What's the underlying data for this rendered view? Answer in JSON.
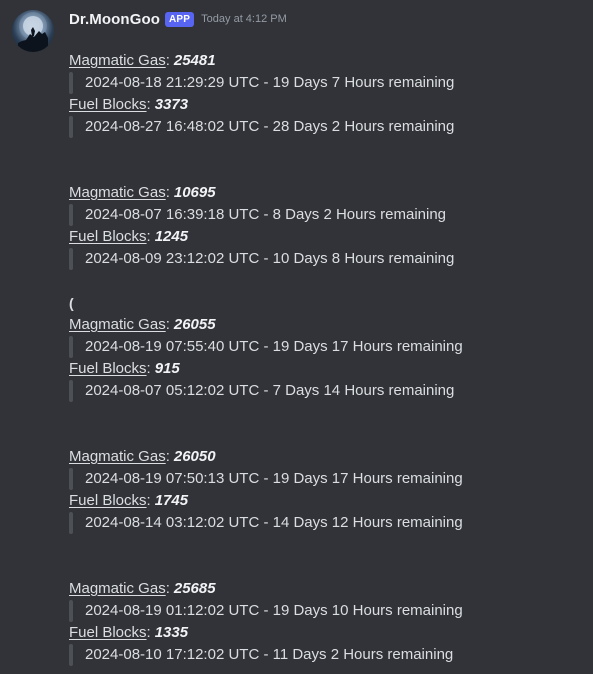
{
  "message": {
    "author": "Dr.MoonGoo",
    "badge": "APP",
    "timestamp": "Today at 4:12 PM",
    "stray_glyph": "(",
    "groups": [
      {
        "gas_label": "Magmatic Gas",
        "gas_value": "25481",
        "gas_detail": "2024-08-18 21:29:29 UTC - 19 Days 7 Hours remaining",
        "fuel_label": "Fuel Blocks",
        "fuel_value": "3373",
        "fuel_detail": "2024-08-27 16:48:02 UTC - 28 Days 2 Hours remaining"
      },
      {
        "gas_label": "Magmatic Gas",
        "gas_value": "10695",
        "gas_detail": "2024-08-07 16:39:18 UTC - 8 Days 2 Hours remaining",
        "fuel_label": "Fuel Blocks",
        "fuel_value": "1245",
        "fuel_detail": "2024-08-09 23:12:02 UTC - 10 Days 8 Hours remaining"
      },
      {
        "gas_label": "Magmatic Gas",
        "gas_value": "26055",
        "gas_detail": "2024-08-19 07:55:40 UTC - 19 Days 17 Hours remaining",
        "fuel_label": "Fuel Blocks",
        "fuel_value": "915",
        "fuel_detail": "2024-08-07 05:12:02 UTC - 7 Days 14 Hours remaining"
      },
      {
        "gas_label": "Magmatic Gas",
        "gas_value": "26050",
        "gas_detail": "2024-08-19 07:50:13 UTC - 19 Days 17 Hours remaining",
        "fuel_label": "Fuel Blocks",
        "fuel_value": "1745",
        "fuel_detail": "2024-08-14 03:12:02 UTC - 14 Days 12 Hours remaining"
      },
      {
        "gas_label": "Magmatic Gas",
        "gas_value": "25685",
        "gas_detail": "2024-08-19 01:12:02 UTC - 19 Days 10 Hours remaining",
        "fuel_label": "Fuel Blocks",
        "fuel_value": "1335",
        "fuel_detail": "2024-08-10 17:12:02 UTC - 11 Days 2 Hours remaining"
      }
    ]
  },
  "colors": {
    "background": "#313338",
    "badge": "#5865f2",
    "text": "#dbdee1",
    "muted": "#949ba4",
    "quote_bar": "#4e5058"
  },
  "icons": {
    "avatar": "moon-silhouette-avatar-icon"
  }
}
